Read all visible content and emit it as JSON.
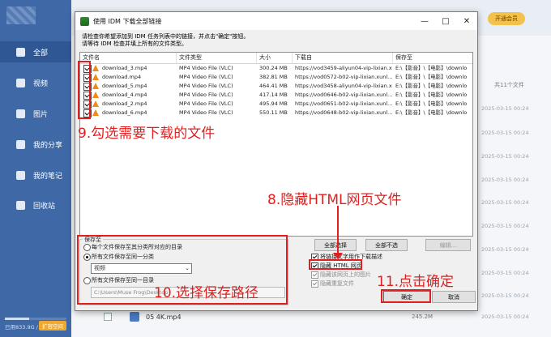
{
  "background": {
    "sidebar": [
      {
        "label": "全部",
        "icon": "doc-icon",
        "active": true
      },
      {
        "label": "视频",
        "icon": "video-icon"
      },
      {
        "label": "图片",
        "icon": "image-icon"
      },
      {
        "label": "我的分享",
        "icon": "share-icon"
      },
      {
        "label": "我的笔记",
        "icon": "note-icon"
      },
      {
        "label": "回收站",
        "icon": "trash-icon"
      }
    ],
    "vip_button": "开通会员",
    "item_count": "共11个文件",
    "dates": [
      "2025-03-15 00:24",
      "2025-03-15 00:24",
      "2025-03-15 00:24",
      "2025-03-15 00:24",
      "2025-03-15 00:24",
      "2025-03-15 00:24",
      "2025-03-15 00:24",
      "2025-03-15 00:24",
      "2025-03-15 00:24"
    ],
    "quota": "已用833.9G / 1T",
    "expand": "扩容空间",
    "file_row": {
      "name": "05 4K.mp4",
      "size": "245.2M",
      "date": "2025-03-15 00:24"
    }
  },
  "dialog": {
    "title": "使用 IDM 下载全部链接",
    "instruction1": "请检查你希望添加到 IDM 任务列表中的链接，并点击\"确定\"按钮。",
    "instruction2": "请等待 IDM 检查并填上所有的文件类型。",
    "columns": [
      "文件名",
      "文件类型",
      "大小",
      "下载自",
      "保存至"
    ],
    "rows": [
      {
        "name": "download_3.mp4",
        "type": "MP4 Video File (VLC)",
        "size": "300.24 MB",
        "from": "https://vod3459-aliyun04-vip-lixian.xunl...",
        "to": "E:\\【影音】\\【电影】\\downlo"
      },
      {
        "name": "download.mp4",
        "type": "MP4 Video File (VLC)",
        "size": "382.81 MB",
        "from": "https://vod0572-b02-vip-lixian.xunl...",
        "to": "E:\\【影音】\\【电影】\\downlo"
      },
      {
        "name": "download_5.mp4",
        "type": "MP4 Video File (VLC)",
        "size": "464.41 MB",
        "from": "https://vod3458-aliyun04-vip-lixian.xunl...",
        "to": "E:\\【影音】\\【电影】\\downlo"
      },
      {
        "name": "download_4.mp4",
        "type": "MP4 Video File (VLC)",
        "size": "417.14 MB",
        "from": "https://vod0646-b02-vip-lixian.xunl...",
        "to": "E:\\【影音】\\【电影】\\downlo"
      },
      {
        "name": "download_2.mp4",
        "type": "MP4 Video File (VLC)",
        "size": "495.94 MB",
        "from": "https://vod0651-b02-vip-lixian.xunl...",
        "to": "E:\\【影音】\\【电影】\\downlo"
      },
      {
        "name": "download_6.mp4",
        "type": "MP4 Video File (VLC)",
        "size": "550.11 MB",
        "from": "https://vod0648-b02-vip-lixian.xunl...",
        "to": "E:\\【影音】\\【电影】\\downlo"
      }
    ],
    "save_group": {
      "title": "保存至",
      "opt1": "每个文件保存至其分类所对应的目录",
      "opt2": "所有文件保存至同一分类",
      "category": "视频",
      "opt3": "所有文件保存至同一目录",
      "path": "C:\\Users\\Muse Frog\\Desktop"
    },
    "buttons": {
      "select_all": "全部选择",
      "deselect_all": "全部不选",
      "edit": "编辑...",
      "ok": "确定",
      "cancel": "取消"
    },
    "checks": {
      "filter_by_link_text": "将链接文字用作下载描述",
      "hide_html": "隐藏 HTML 网页",
      "hide_images": "隐藏该网页上的图片",
      "hide_duplicates": "隐藏重复文件"
    }
  },
  "annotations": {
    "a9": "9.勾选需要下载的文件",
    "a8": "8.隐藏HTML网页文件",
    "a10": "10.选择保存路径",
    "a11": "11.点击确定"
  },
  "colors": {
    "annotation": "#e02020",
    "sidebar": "#3f68a6"
  }
}
